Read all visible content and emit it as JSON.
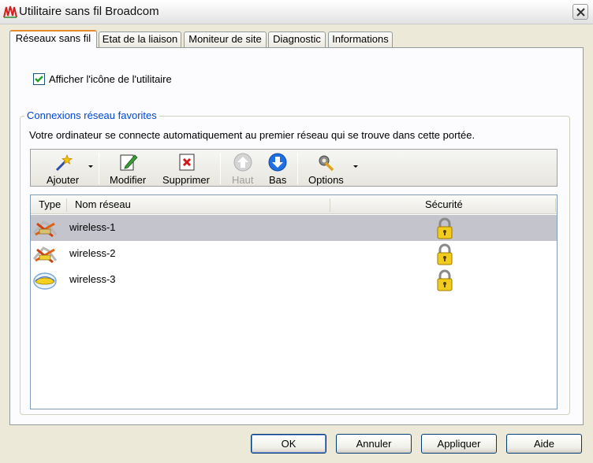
{
  "window": {
    "title": "Utilitaire sans fil Broadcom"
  },
  "tabs": [
    {
      "label": "Réseaux sans fil",
      "active": true
    },
    {
      "label": "Etat de la liaison",
      "active": false
    },
    {
      "label": "Moniteur de site",
      "active": false
    },
    {
      "label": "Diagnostic",
      "active": false
    },
    {
      "label": "Informations",
      "active": false
    }
  ],
  "show_icon": {
    "label": "Afficher l'icône de l'utilitaire",
    "checked": true
  },
  "favorites": {
    "title": "Connexions réseau favorites",
    "description": "Votre ordinateur se connecte automatiquement au premier réseau qui se trouve dans cette portée."
  },
  "toolbar": {
    "add": "Ajouter",
    "edit": "Modifier",
    "delete": "Supprimer",
    "up": "Haut",
    "down": "Bas",
    "options": "Options"
  },
  "list": {
    "columns": {
      "type": "Type",
      "name": "Nom réseau",
      "security": "Sécurité"
    },
    "rows": [
      {
        "name": "wireless-1",
        "type_icon": "adhoc-network-icon",
        "security_icon": "lock-icon",
        "selected": true
      },
      {
        "name": "wireless-2",
        "type_icon": "adhoc-network-icon",
        "security_icon": "lock-icon",
        "selected": false
      },
      {
        "name": "wireless-3",
        "type_icon": "access-point-icon",
        "security_icon": "lock-icon",
        "selected": false
      }
    ]
  },
  "buttons": {
    "ok": "OK",
    "cancel": "Annuler",
    "apply": "Appliquer",
    "help": "Aide"
  },
  "colors": {
    "tab_highlight": "#e68b2c",
    "group_title": "#0046d5",
    "selected_row": "#c4c4cc"
  }
}
